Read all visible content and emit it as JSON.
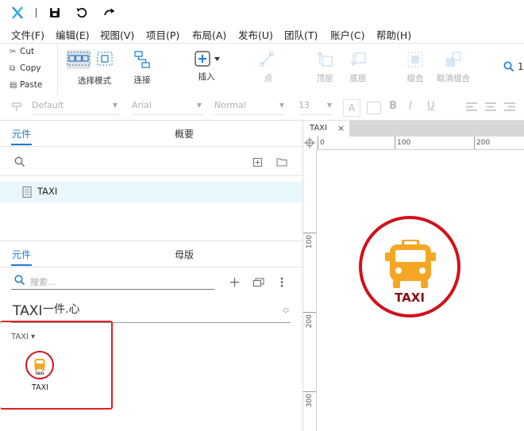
{
  "menu": [
    "文件(F)",
    "编辑(E)",
    "视图(V)",
    "项目(P)",
    "布局(A)",
    "发布(U)",
    "团队(T)",
    "账户(C)",
    "帮助(H)"
  ],
  "clipboard": {
    "cut": "Cut",
    "copy": "Copy",
    "paste": "Paste"
  },
  "tools": {
    "select_mode": "选择模式",
    "connect": "连接",
    "insert": "插入",
    "point": "点",
    "top_layer": "顶层",
    "bottom_layer": "底层",
    "group": "组合",
    "ungroup": "取消组合"
  },
  "search_partial": "1",
  "format": {
    "style": "Default",
    "font": "Arial",
    "weight": "Normal",
    "size": "13"
  },
  "pages_panel": {
    "tab_active": "元件",
    "tab_other": "概要",
    "page_name": "TAXI"
  },
  "library_panel": {
    "tab_active": "元件",
    "tab_other": "母版",
    "search_placeholder": "搜索...",
    "library_name": "TAXI",
    "library_name_overlap": "一件.心",
    "group_label": "TAXI ▾",
    "widget_label": "TAXI",
    "widget_icon_text": "TAXI"
  },
  "canvas": {
    "tab_label": "TAXI",
    "ruler_h": [
      "0",
      "100",
      "200"
    ],
    "ruler_v": [
      "100",
      "200",
      "300"
    ],
    "taxi_text": "TAXI"
  },
  "colors": {
    "accent": "#1a7bd1",
    "taxi_red": "#d0111b",
    "taxi_orange": "#f5a623",
    "highlight_row": "#e8f7fb",
    "selection_box": "#e02020"
  }
}
